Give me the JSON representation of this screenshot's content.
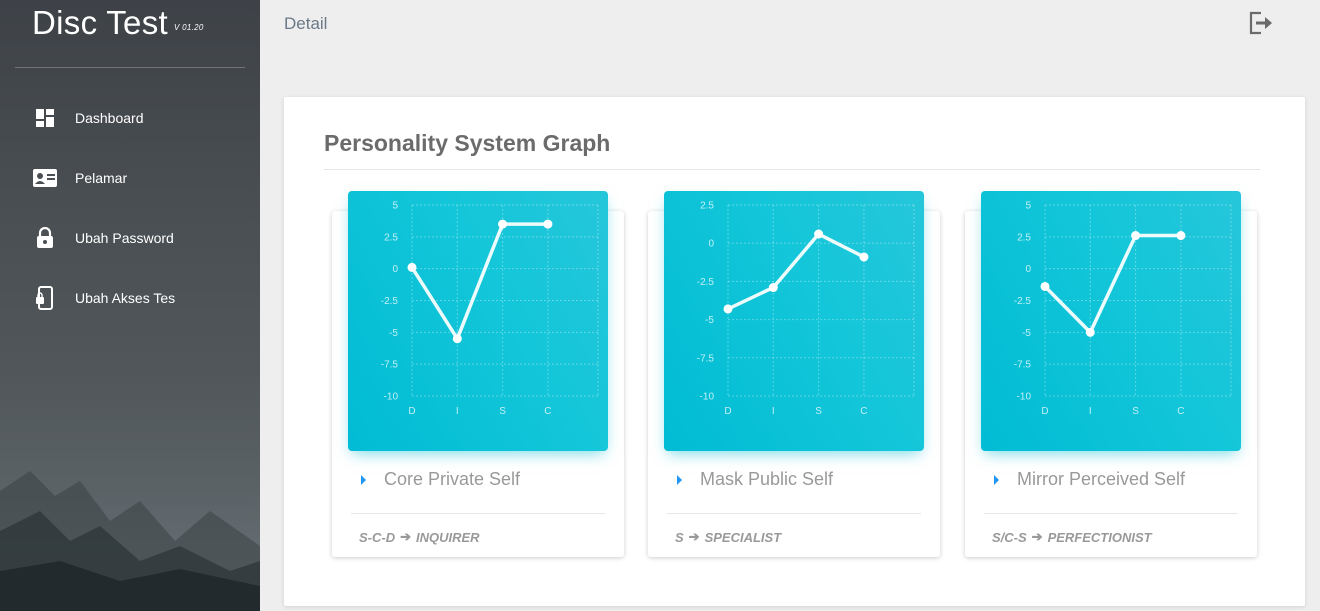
{
  "app": {
    "name": "Disc Test",
    "version": "V 01.20"
  },
  "sidebar": {
    "items": [
      {
        "label": "Dashboard",
        "icon": "dashboard-icon"
      },
      {
        "label": "Pelamar",
        "icon": "id-card-icon"
      },
      {
        "label": "Ubah Password",
        "icon": "lock-icon"
      },
      {
        "label": "Ubah Akses Tes",
        "icon": "phone-lock-icon"
      }
    ]
  },
  "topbar": {
    "title": "Detail",
    "logout_icon": "logout-icon"
  },
  "main": {
    "title": "Personality System Graph"
  },
  "colors": {
    "chart_bg": "#00bcd4",
    "accent": "#2196f3",
    "line": "#ffffff"
  },
  "cards": [
    {
      "subtitle": "Core Private Self",
      "foot_code": "S-C-D",
      "foot_type": "INQUIRER"
    },
    {
      "subtitle": "Mask Public Self",
      "foot_code": "S",
      "foot_type": "SPECIALIST"
    },
    {
      "subtitle": "Mirror Perceived Self",
      "foot_code": "S/C-S",
      "foot_type": "PERFECTIONIST"
    }
  ],
  "chart_data": [
    {
      "type": "line",
      "categories": [
        "D",
        "I",
        "S",
        "C"
      ],
      "values": [
        0.1,
        -5.5,
        3.5,
        3.5
      ],
      "ylim": [
        -10,
        5
      ],
      "yticks": [
        "5",
        "2.5",
        "0",
        "-2.5",
        "-5",
        "-7.5",
        "-10"
      ],
      "grid": true
    },
    {
      "type": "line",
      "categories": [
        "D",
        "I",
        "S",
        "C"
      ],
      "values": [
        -4.3,
        -2.9,
        0.6,
        -0.9
      ],
      "ylim": [
        -10,
        2.5
      ],
      "yticks": [
        "2.5",
        "0",
        "-2.5",
        "-5",
        "-7.5",
        "-10"
      ],
      "grid": true
    },
    {
      "type": "line",
      "categories": [
        "D",
        "I",
        "S",
        "C"
      ],
      "values": [
        -1.4,
        -5.0,
        2.6,
        2.6
      ],
      "ylim": [
        -10,
        5
      ],
      "yticks": [
        "5",
        "2.5",
        "0",
        "-2.5",
        "-5",
        "-7.5",
        "-10"
      ],
      "grid": true
    }
  ],
  "card_arrow": "➔"
}
